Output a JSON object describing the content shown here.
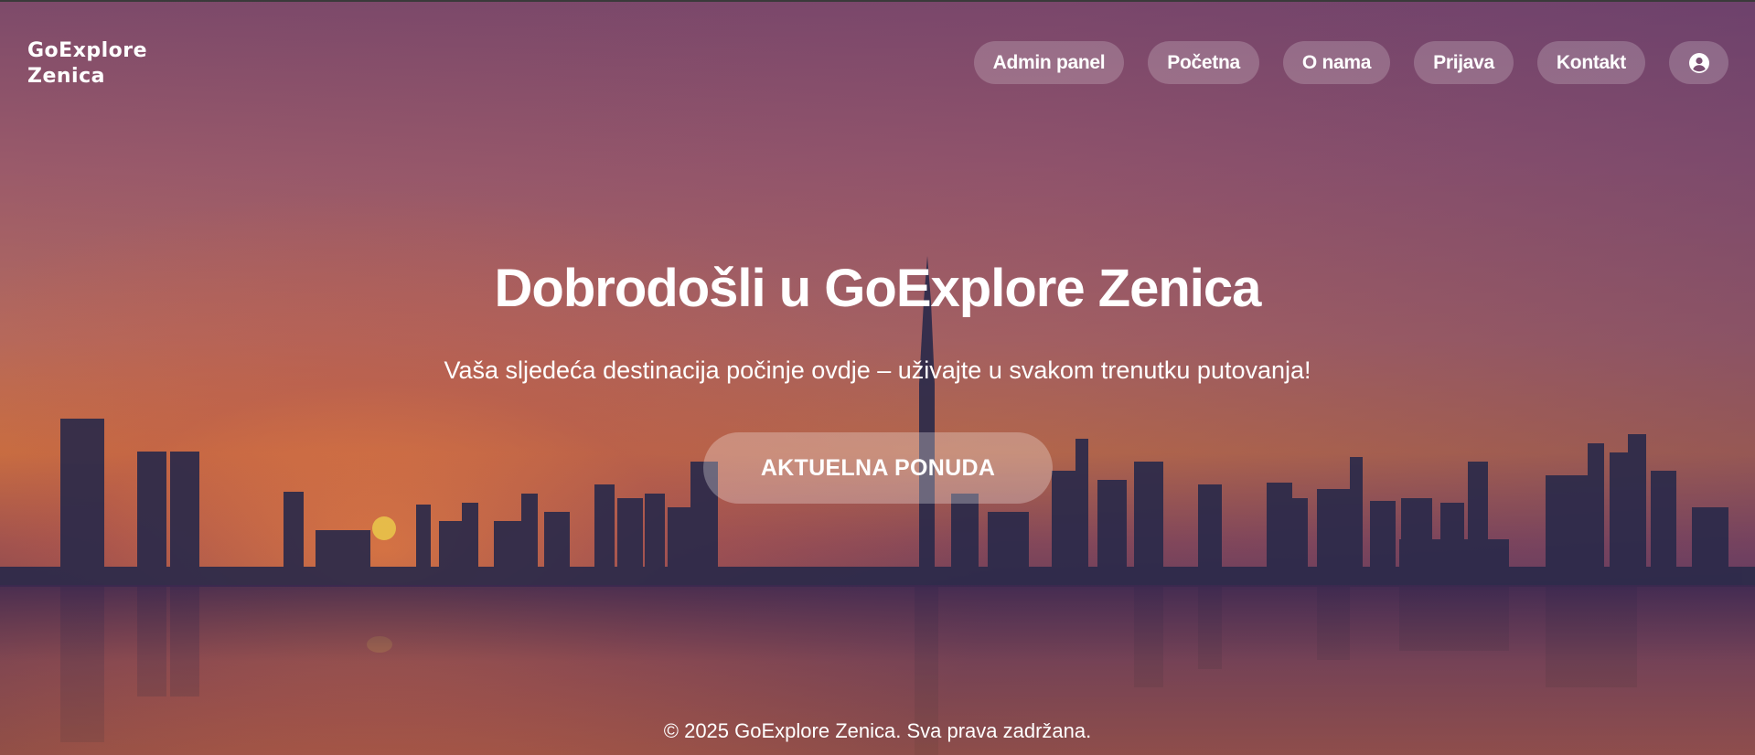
{
  "header": {
    "logo_text": "GoExplore Zenica",
    "nav": [
      {
        "label": "Admin panel"
      },
      {
        "label": "Početna"
      },
      {
        "label": "O nama"
      },
      {
        "label": "Prijava"
      },
      {
        "label": "Kontakt"
      }
    ],
    "profile_icon": "user-circle-icon"
  },
  "hero": {
    "title": "Dobrodošli u GoExplore Zenica",
    "subtitle": "Vaša sljedeća destinacija počinje ovdje – uživajte u svakom trenutku putovanja!",
    "cta_label": "AKTUELNA PONUDA"
  },
  "footer": {
    "copyright": "© 2025 GoExplore Zenica. Sva prava zadržana."
  }
}
